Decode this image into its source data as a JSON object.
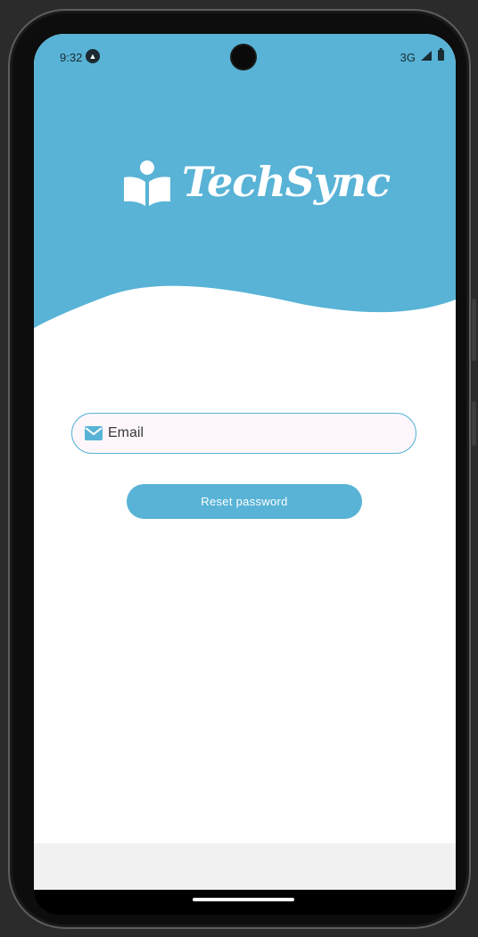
{
  "status_bar": {
    "time": "9:32",
    "network": "3G"
  },
  "app": {
    "name": "TechSync",
    "brand_color": "#58b3d6"
  },
  "form": {
    "email_placeholder": "Email",
    "email_value": "",
    "reset_label": "Reset password"
  },
  "icons": {
    "logo": "reader-book-icon",
    "email": "mail-icon",
    "alert": "alert-icon",
    "signal": "signal-icon",
    "battery": "battery-icon"
  }
}
